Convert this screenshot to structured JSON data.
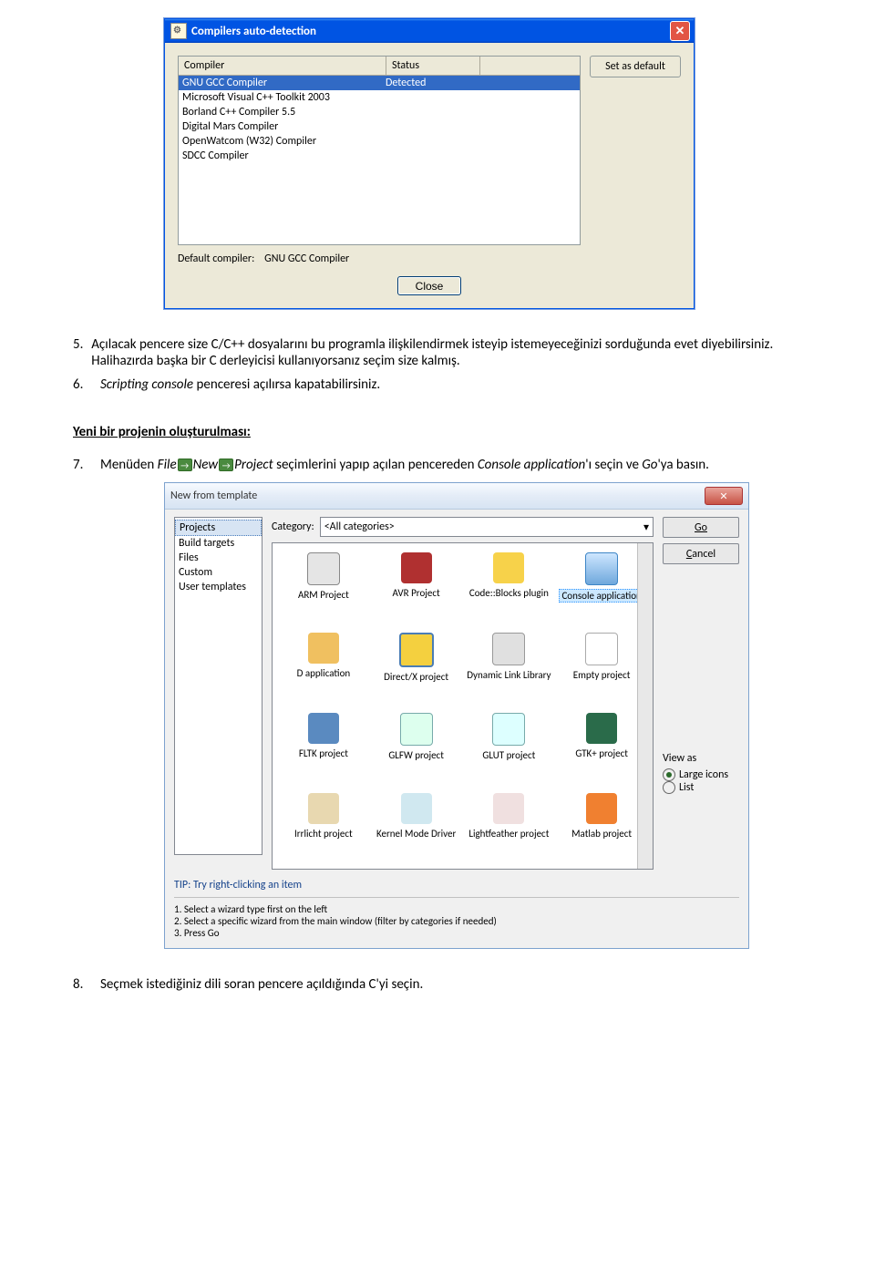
{
  "dialog1": {
    "title": "Compilers auto-detection",
    "columns": {
      "compiler": "Compiler",
      "status": "Status"
    },
    "set_default_btn": "Set as default",
    "rows": [
      {
        "name": "GNU GCC Compiler",
        "status": "Detected",
        "selected": true
      },
      {
        "name": "Microsoft Visual C++ Toolkit 2003",
        "status": "",
        "selected": false
      },
      {
        "name": "Borland C++ Compiler 5.5",
        "status": "",
        "selected": false
      },
      {
        "name": "Digital Mars Compiler",
        "status": "",
        "selected": false
      },
      {
        "name": "OpenWatcom (W32) Compiler",
        "status": "",
        "selected": false
      },
      {
        "name": "SDCC Compiler",
        "status": "",
        "selected": false
      }
    ],
    "default_label": "Default compiler:",
    "default_value": "GNU GCC Compiler",
    "close_btn": "Close"
  },
  "text": {
    "item5_num": "5.",
    "item5_body": "Açılacak pencere size C/C++ dosyalarını bu programla ilişkilendirmek isteyip istemeyeceğinizi sorduğunda evet diyebilirsiniz. Halihazırda başka bir C derleyicisi kullanıyorsanız seçim size kalmış.",
    "item6_num": "6.",
    "item6_italic_a": "Scripting console",
    "item6_rest": " penceresi açılırsa kapatabilirsiniz.",
    "heading": "Yeni bir projenin oluşturulması:",
    "item7_num": "7.",
    "item7_a": "Menüden ",
    "item7_file": "File",
    "item7_new": "New",
    "item7_project": "Project",
    "item7_b": " seçimlerini yapıp açılan pencereden ",
    "item7_console": "Console application",
    "item7_c": "'ı seçin ve ",
    "item7_go": "Go",
    "item7_d": "'ya basın.",
    "item8_num": "8.",
    "item8_body": "Seçmek istediğiniz dili soran pencere açıldığında C'yi seçin."
  },
  "dialog2": {
    "title": "New from template",
    "left_items": [
      "Projects",
      "Build targets",
      "Files",
      "Custom",
      "User templates"
    ],
    "left_selected_index": 0,
    "category_label": "Category:",
    "category_value": "<All categories>",
    "go_btn": "Go",
    "cancel_btn_plain": "C",
    "cancel_btn_rest": "ancel",
    "view_as_label": "View as",
    "view_large": "Large icons",
    "view_list": "List",
    "templates": [
      {
        "label": "ARM Project",
        "iconClass": "ic-chip"
      },
      {
        "label": "AVR Project",
        "iconClass": "ic-avr"
      },
      {
        "label": "Code::Blocks plugin",
        "iconClass": "ic-puzzle"
      },
      {
        "label": "Console application",
        "iconClass": "ic-console",
        "selected": true
      },
      {
        "label": "D application",
        "iconClass": "ic-shell"
      },
      {
        "label": "Direct/X project",
        "iconClass": "ic-dx"
      },
      {
        "label": "Dynamic Link Library",
        "iconClass": "ic-dll"
      },
      {
        "label": "Empty project",
        "iconClass": "ic-empty"
      },
      {
        "label": "FLTK project",
        "iconClass": "ic-fltk"
      },
      {
        "label": "GLFW project",
        "iconClass": "ic-glfw"
      },
      {
        "label": "GLUT project",
        "iconClass": "ic-glut"
      },
      {
        "label": "GTK+ project",
        "iconClass": "ic-gtk"
      },
      {
        "label": "Irrlicht project",
        "iconClass": "ic-irr"
      },
      {
        "label": "Kernel Mode Driver",
        "iconClass": "ic-kernel"
      },
      {
        "label": "Lightfeather project",
        "iconClass": "ic-lf"
      },
      {
        "label": "Matlab project",
        "iconClass": "ic-matlab"
      }
    ],
    "tip": "TIP: Try right-clicking an item",
    "steps": [
      "1. Select a wizard type first on the left",
      "2. Select a specific wizard from the main window (filter by categories if needed)",
      "3. Press Go"
    ]
  }
}
